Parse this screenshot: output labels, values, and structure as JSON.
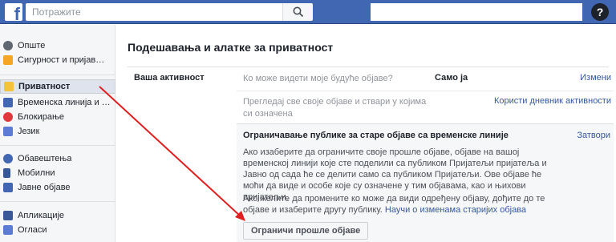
{
  "topbar": {
    "search_placeholder": "Потражите",
    "help_label": "?",
    "brand_color": "#4267b2"
  },
  "sidebar": {
    "items": [
      {
        "label": "Опште",
        "icon": "gear-icon"
      },
      {
        "label": "Сигурност и пријављив...",
        "icon": "shield-icon"
      },
      {
        "label": "Приватност",
        "icon": "lock-icon"
      },
      {
        "label": "Временска линија и оз...",
        "icon": "timeline-icon"
      },
      {
        "label": "Блокирање",
        "icon": "block-icon"
      },
      {
        "label": "Језик",
        "icon": "language-icon"
      },
      {
        "label": "Обавештења",
        "icon": "globe-icon"
      },
      {
        "label": "Мобилни",
        "icon": "mobile-icon"
      },
      {
        "label": "Јавне објаве",
        "icon": "rss-icon"
      },
      {
        "label": "Апликације",
        "icon": "apps-icon"
      },
      {
        "label": "Огласи",
        "icon": "ads-icon"
      }
    ],
    "active_index": 2
  },
  "main": {
    "title": "Подешавања и алатке за приватност",
    "section_label": "Ваша активност",
    "rows": [
      {
        "text": "Ко може видети моје будуће објаве?",
        "value": "Само ја",
        "action": "Измени"
      },
      {
        "text": "Прегледај све своје објаве и ствари у којима си означена",
        "value": "",
        "action": "Користи дневник активности"
      }
    ],
    "expanded": {
      "title": "Ограничавање публике за старе објаве са временске линије",
      "close_label": "Затвори",
      "paragraph1": "Ако изаберите да ограничите своје прошле објаве, објаве на вашој временској линији које сте поделили са публиком Пријатељи пријатеља и Јавно од сада ће се делити само са публиком Пријатељи. Ове објаве ће моћи да виде и особе које су означене у тим објавама, као и њихови пријатељи.",
      "paragraph2": "Ако желите да промените ко може да види одређену објаву, дођите до те објаве и изаберите другу публику.",
      "link": "Научи о изменама старијих објава",
      "button_label": "Ограничи прошле објаве"
    }
  },
  "annotation": {
    "arrow_color": "#e02020"
  }
}
